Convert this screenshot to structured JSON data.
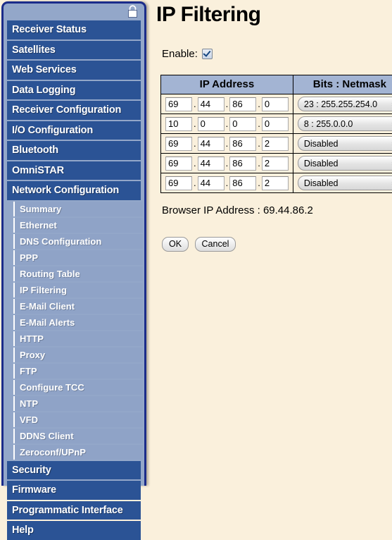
{
  "sidebar": {
    "lock_icon": "lock-icon",
    "menu": [
      {
        "label": "Receiver Status",
        "name": "receiver-status"
      },
      {
        "label": "Satellites",
        "name": "satellites"
      },
      {
        "label": "Web Services",
        "name": "web-services"
      },
      {
        "label": "Data Logging",
        "name": "data-logging"
      },
      {
        "label": "Receiver Configuration",
        "name": "receiver-configuration"
      },
      {
        "label": "I/O Configuration",
        "name": "io-configuration"
      },
      {
        "label": "Bluetooth",
        "name": "bluetooth"
      },
      {
        "label": "OmniSTAR",
        "name": "omnistar"
      },
      {
        "label": "Network Configuration",
        "name": "network-configuration"
      }
    ],
    "submenu": [
      {
        "label": "Summary",
        "name": "summary"
      },
      {
        "label": "Ethernet",
        "name": "ethernet"
      },
      {
        "label": "DNS Configuration",
        "name": "dns-configuration"
      },
      {
        "label": "PPP",
        "name": "ppp"
      },
      {
        "label": "Routing Table",
        "name": "routing-table"
      },
      {
        "label": "IP Filtering",
        "name": "ip-filtering"
      },
      {
        "label": "E-Mail Client",
        "name": "e-mail-client"
      },
      {
        "label": "E-Mail Alerts",
        "name": "e-mail-alerts"
      },
      {
        "label": "HTTP",
        "name": "http"
      },
      {
        "label": "Proxy",
        "name": "proxy"
      },
      {
        "label": "FTP",
        "name": "ftp"
      },
      {
        "label": "Configure TCC",
        "name": "configure-tcc"
      },
      {
        "label": "NTP",
        "name": "ntp"
      },
      {
        "label": "VFD",
        "name": "vfd"
      },
      {
        "label": "DDNS Client",
        "name": "ddns-client"
      },
      {
        "label": "Zeroconf/UPnP",
        "name": "zeroconf-upnp"
      }
    ],
    "menu_bottom": [
      {
        "label": "Security",
        "name": "security"
      },
      {
        "label": "Firmware",
        "name": "firmware"
      },
      {
        "label": "Programmatic Interface",
        "name": "programmatic-interface"
      },
      {
        "label": "Help",
        "name": "help"
      }
    ]
  },
  "main": {
    "title": "IP Filtering",
    "enable_label": "Enable:",
    "enable_checked": true,
    "table": {
      "headers": [
        "IP Address",
        "Bits : Netmask"
      ],
      "rows": [
        {
          "octets": [
            "69",
            "44",
            "86",
            "0"
          ],
          "netmask": "23 : 255.255.254.0"
        },
        {
          "octets": [
            "10",
            "0",
            "0",
            "0"
          ],
          "netmask": "8 : 255.0.0.0"
        },
        {
          "octets": [
            "69",
            "44",
            "86",
            "2"
          ],
          "netmask": "Disabled"
        },
        {
          "octets": [
            "69",
            "44",
            "86",
            "2"
          ],
          "netmask": "Disabled"
        },
        {
          "octets": [
            "69",
            "44",
            "86",
            "2"
          ],
          "netmask": "Disabled"
        }
      ],
      "netmask_options": [
        "Disabled",
        "8 : 255.0.0.0",
        "23 : 255.255.254.0"
      ]
    },
    "browser_ip_text": "Browser IP Address : 69.44.86.2",
    "ok_label": "OK",
    "cancel_label": "Cancel"
  },
  "colors": {
    "page_bg": "#faf0dc",
    "sidebar_border": "#1b2c8a",
    "sidebar_panel": "#93a7c9",
    "menu_item": "#2b5395",
    "submenu_item": "#8fa3c7",
    "table_header": "#a3b4d3"
  }
}
